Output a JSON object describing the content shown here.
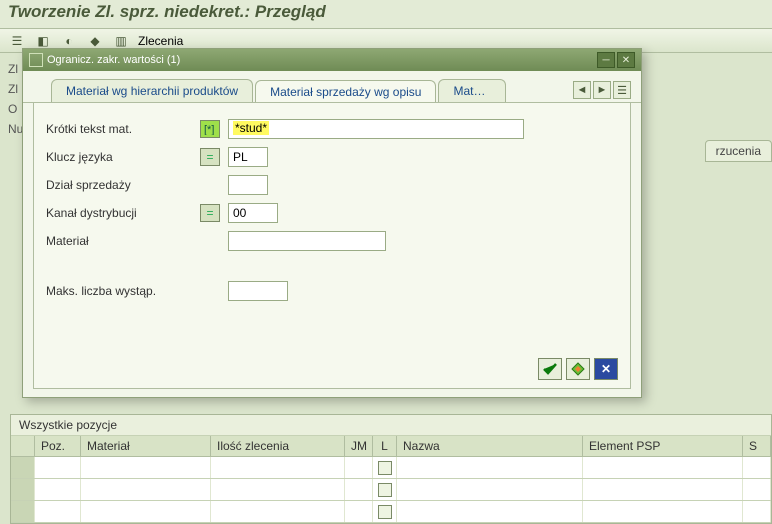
{
  "page": {
    "title": "Tworzenie Zl. sprz. niedekret.: Przegląd"
  },
  "toolbar": {
    "zlecenia_label": "Zlecenia"
  },
  "bg": {
    "line1": "Zl",
    "line2": "Zl",
    "line3": "O",
    "line4": "Nu",
    "tab_rzucenia": "rzucenia"
  },
  "modal": {
    "title": "Ogranicz. zakr. wartości (1)",
    "tabs": {
      "t1": "Materiał wg hierarchii produktów",
      "t2": "Materiał sprzedaży wg opisu",
      "t3": "Materi..."
    },
    "fields": {
      "krotki_tekst_label": "Krótki tekst mat.",
      "krotki_tekst_value": "*stud*",
      "klucz_jezyka_label": "Klucz języka",
      "klucz_jezyka_value": "PL",
      "dzial_label": "Dział sprzedaży",
      "dzial_value": "",
      "kanal_label": "Kanał dystrybucji",
      "kanal_value": "00",
      "material_label": "Materiał",
      "material_value": "",
      "maks_label": "Maks. liczba wystąp.",
      "maks_value": ""
    }
  },
  "grid": {
    "title": "Wszystkie pozycje",
    "cols": {
      "poz": "Poz.",
      "mat": "Materiał",
      "ilo": "Ilość zlecenia",
      "jm": "JM",
      "l": "L",
      "naz": "Nazwa",
      "psp": "Element PSP",
      "st": "S"
    }
  }
}
